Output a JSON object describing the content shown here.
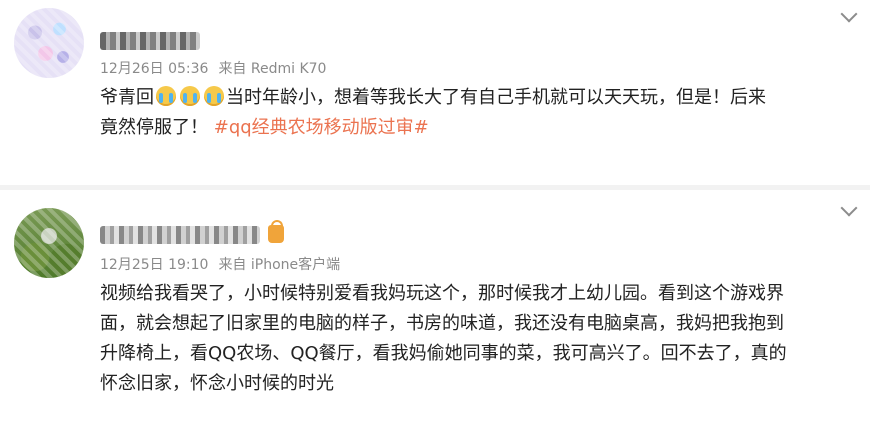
{
  "posts": [
    {
      "timestamp": "12月26日 05:36",
      "source": "来自 Redmi K70",
      "text_line1_prefix": "爷青回",
      "text_line1_rest": "当时年龄小，想着等我长大了有自己手机就可以天天玩，但是！后来",
      "text_line2_prefix": "竟然停服了！",
      "hashtag": "#qq经典农场移动版过审#",
      "emoji_icons": [
        "crying-face-icon",
        "crying-face-icon",
        "crying-face-icon"
      ]
    },
    {
      "timestamp": "12月25日 19:10",
      "source": "来自 iPhone客户端",
      "lines": [
        "视频给我看哭了，小时候特别爱看我妈玩这个，那时候我才上幼儿园。看到这个游戏界",
        "面，就会想起了旧家里的电脑的样子，书房的味道，我还没有电脑桌高，我妈把我抱到",
        "升降椅上，看QQ农场、QQ餐厅，看我妈偷她同事的菜，我可高兴了。回不去了，真的",
        "怀念旧家，怀念小时候的时光"
      ]
    }
  ],
  "colors": {
    "hashtag": "#eb7350",
    "meta": "#8a8a8a",
    "text": "#222222"
  }
}
